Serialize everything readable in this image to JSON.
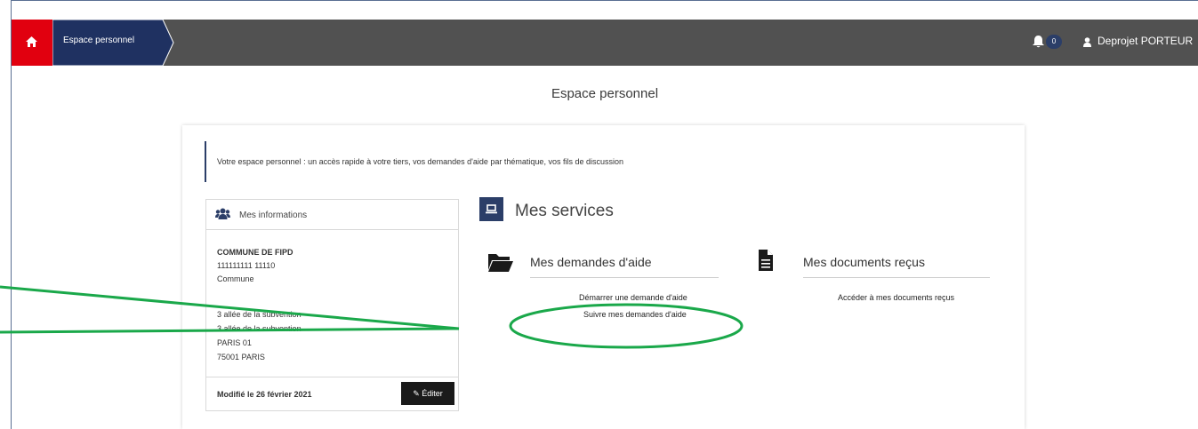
{
  "topbar": {
    "home_label": "Accueil",
    "breadcrumb": "Espace personnel",
    "notification_count": "0",
    "user_name": "Deprojet PORTEUR"
  },
  "page": {
    "title": "Espace personnel",
    "intro": "Votre espace personnel : un accès rapide à votre tiers, vos demandes d'aide par thématique, vos fils de discussion"
  },
  "info": {
    "title": "Mes informations",
    "org": "COMMUNE DE FIPD",
    "siret": "111111111 11110",
    "type": "Commune",
    "addr1": "3 allée de la subvention",
    "addr2": "3 allée de la subvention",
    "addr3": "PARIS 01",
    "addr4": "75001 PARIS",
    "modified": "Modifié le 26 février 2021",
    "edit_label": "Éditer"
  },
  "services": {
    "title": "Mes services",
    "aid": {
      "title": "Mes demandes d'aide",
      "link_start": "Démarrer une demande d'aide",
      "link_follow": "Suivre mes demandes d'aide"
    },
    "docs": {
      "title": "Mes documents reçus",
      "link_access": "Accéder à mes documents reçus"
    }
  },
  "colors": {
    "accent_red": "#e1000f",
    "navy": "#2b3e68",
    "topbar": "#515151",
    "annotation_green": "#1aa84a"
  }
}
